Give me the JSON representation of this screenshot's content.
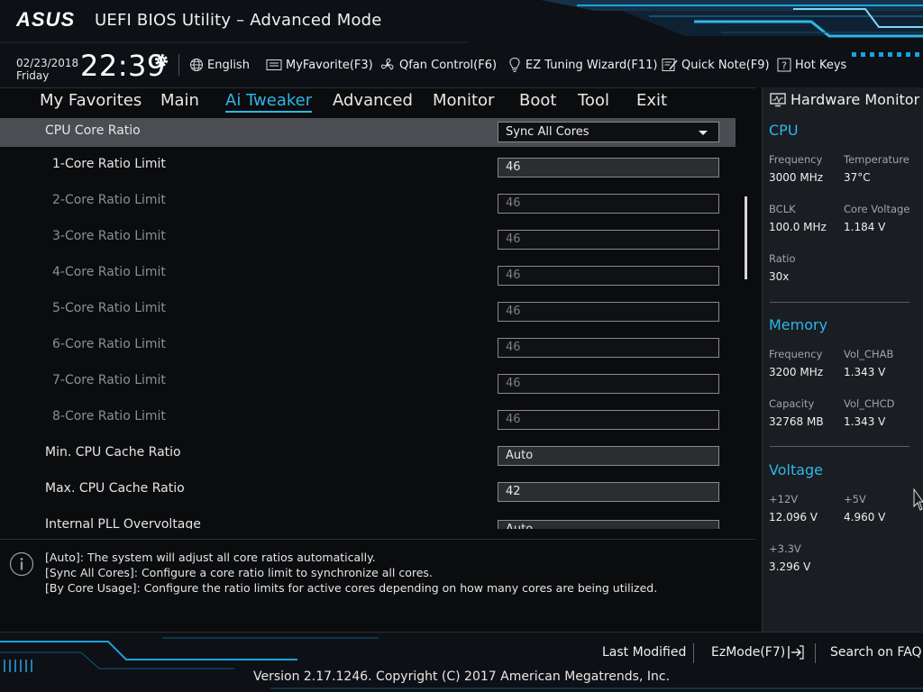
{
  "header": {
    "logo_text": "ASUS",
    "title": "UEFI BIOS Utility – Advanced Mode",
    "date": "02/23/2018",
    "day": "Friday",
    "time": "22:39",
    "buttons": [
      {
        "label": "English",
        "icon": "globe-icon"
      },
      {
        "label": "MyFavorite(F3)",
        "icon": "favorite-icon"
      },
      {
        "label": "Qfan Control(F6)",
        "icon": "fan-icon"
      },
      {
        "label": "EZ Tuning Wizard(F11)",
        "icon": "bulb-icon"
      },
      {
        "label": "Quick Note(F9)",
        "icon": "note-icon"
      },
      {
        "label": "Hot Keys",
        "icon": "question-icon"
      }
    ]
  },
  "nav": {
    "tabs": [
      "My Favorites",
      "Main",
      "Ai Tweaker",
      "Advanced",
      "Monitor",
      "Boot",
      "Tool",
      "Exit"
    ],
    "active": "Ai Tweaker"
  },
  "settings": [
    {
      "label": "CPU Core Ratio",
      "value": "Sync All Cores",
      "type": "dropdown",
      "state": "selected"
    },
    {
      "label": "1-Core Ratio Limit",
      "value": "46",
      "type": "field",
      "state": "enabled"
    },
    {
      "label": "2-Core Ratio Limit",
      "value": "46",
      "type": "field",
      "state": "disabled"
    },
    {
      "label": "3-Core Ratio Limit",
      "value": "46",
      "type": "field",
      "state": "disabled"
    },
    {
      "label": "4-Core Ratio Limit",
      "value": "46",
      "type": "field",
      "state": "disabled"
    },
    {
      "label": "5-Core Ratio Limit",
      "value": "46",
      "type": "field",
      "state": "disabled"
    },
    {
      "label": "6-Core Ratio Limit",
      "value": "46",
      "type": "field",
      "state": "disabled"
    },
    {
      "label": "7-Core Ratio Limit",
      "value": "46",
      "type": "field",
      "state": "disabled"
    },
    {
      "label": "8-Core Ratio Limit",
      "value": "46",
      "type": "field",
      "state": "disabled"
    },
    {
      "label": "Min. CPU Cache Ratio",
      "value": "Auto",
      "type": "field",
      "state": "enabled"
    },
    {
      "label": "Max. CPU Cache Ratio",
      "value": "42",
      "type": "field",
      "state": "enabled"
    },
    {
      "label": "Internal PLL Overvoltage",
      "value": "Auto",
      "type": "field",
      "state": "enabled"
    }
  ],
  "help": {
    "lines": [
      "[Auto]: The system will adjust all core ratios automatically.",
      "[Sync All Cores]: Configure a core ratio limit to synchronize all cores.",
      "[By Core Usage]: Configure the ratio limits for active cores depending on how many cores are being utilized."
    ]
  },
  "hw_monitor": {
    "title": "Hardware Monitor",
    "cpu": {
      "title": "CPU",
      "frequency_label": "Frequency",
      "frequency": "3000 MHz",
      "temperature_label": "Temperature",
      "temperature": "37°C",
      "bclk_label": "BCLK",
      "bclk": "100.0 MHz",
      "core_voltage_label": "Core Voltage",
      "core_voltage": "1.184 V",
      "ratio_label": "Ratio",
      "ratio": "30x"
    },
    "memory": {
      "title": "Memory",
      "frequency_label": "Frequency",
      "frequency": "3200 MHz",
      "vol_chab_label": "Vol_CHAB",
      "vol_chab": "1.343 V",
      "capacity_label": "Capacity",
      "capacity": "32768 MB",
      "vol_chcd_label": "Vol_CHCD",
      "vol_chcd": "1.343 V"
    },
    "voltage": {
      "title": "Voltage",
      "v12_label": "+12V",
      "v12": "12.096 V",
      "v5_label": "+5V",
      "v5": "4.960 V",
      "v33_label": "+3.3V",
      "v33": "3.296 V"
    }
  },
  "footer": {
    "last_modified": "Last Modified",
    "ezmode": "EzMode(F7)",
    "search_faq": "Search on FAQ",
    "copyright": "Version 2.17.1246. Copyright (C) 2017 American Megatrends, Inc."
  },
  "colors": {
    "accent": "#2fb6e9",
    "background": "#0b0c0e",
    "panel": "#1a1d21",
    "selected_row": "#4a4d52"
  }
}
